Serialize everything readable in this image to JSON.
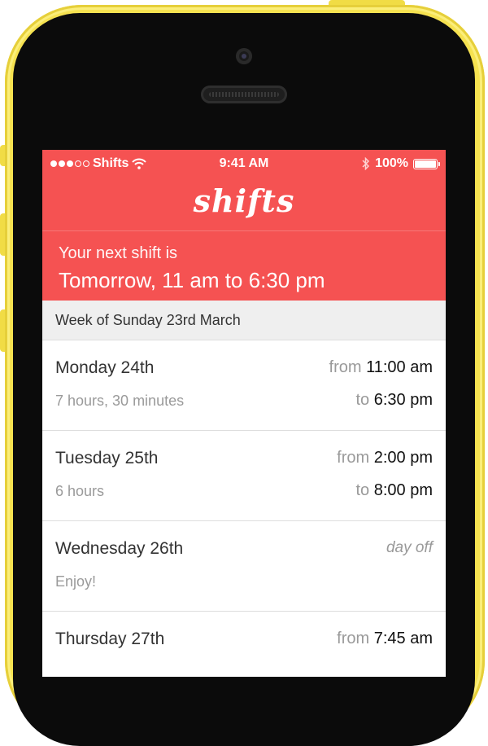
{
  "status_bar": {
    "carrier": "Shifts",
    "time": "9:41 AM",
    "battery": "100%"
  },
  "app": {
    "logo": "shifts"
  },
  "next_shift": {
    "label": "Your next shift is",
    "value": "Tomorrow, 11 am to 6:30 pm"
  },
  "week_header": "Week of Sunday 23rd March",
  "shifts": [
    {
      "day": "Monday 24th",
      "duration": "7 hours, 30 minutes",
      "from_label": "from",
      "from": "11:00 am",
      "to_label": "to",
      "to": "6:30 pm"
    },
    {
      "day": "Tuesday 25th",
      "duration": "6 hours",
      "from_label": "from",
      "from": "2:00 pm",
      "to_label": "to",
      "to": "8:00 pm"
    },
    {
      "day": "Wednesday 26th",
      "duration": "Enjoy!",
      "status": "day off"
    },
    {
      "day": "Thursday 27th",
      "from_label": "from",
      "from": "7:45 am"
    }
  ]
}
